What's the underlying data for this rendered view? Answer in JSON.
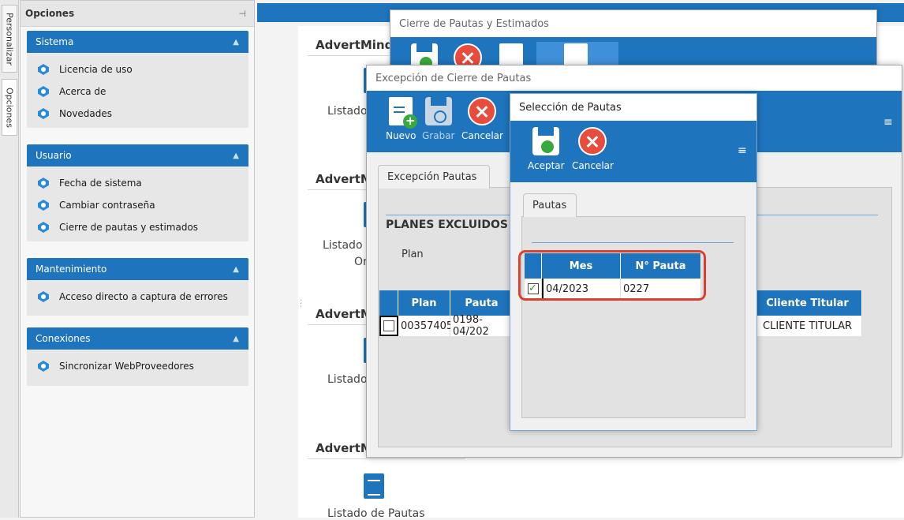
{
  "tabs_vertical": [
    "Personalizar",
    "Opciones"
  ],
  "options_panel": {
    "title": "Opciones",
    "groups": [
      {
        "title": "Sistema",
        "items": [
          "Licencia de uso",
          "Acerca de",
          "Novedades"
        ]
      },
      {
        "title": "Usuario",
        "items": [
          "Fecha de sistema",
          "Cambiar contraseña",
          "Cierre de pautas y estimados"
        ]
      },
      {
        "title": "Mantenimiento",
        "items": [
          "Acceso directo a captura de errores"
        ]
      },
      {
        "title": "Conexiones",
        "items": [
          "Sincronizar WebProveedores"
        ]
      }
    ]
  },
  "main": {
    "sections": [
      "AdvertMind",
      "AdvertM",
      "AdvertM",
      "AdvertM"
    ],
    "listados": [
      "Listado",
      "Listado",
      "Or",
      "Listado",
      "Listado de Pautas"
    ]
  },
  "win_cierre": {
    "title": "Cierre de Pautas y Estimados"
  },
  "win_excepcion": {
    "title": "Excepción de Cierre de Pautas",
    "toolbar": {
      "nuevo": "Nuevo",
      "grabar": "Grabar",
      "cancelar": "Cancelar"
    },
    "tab": "Excepción Pautas",
    "section_title": "PLANES EXCLUIDOS",
    "plan_label": "Plan",
    "grid": {
      "headers": [
        "Plan",
        "Pauta",
        "Cliente Titular"
      ],
      "row": [
        "00357405",
        "0198-04/202",
        "CLIENTE TITULAR"
      ]
    }
  },
  "win_seleccion": {
    "title": "Selección de Pautas",
    "toolbar": {
      "aceptar": "Aceptar",
      "cancelar": "Cancelar"
    },
    "tab": "Pautas",
    "grid": {
      "headers": [
        "Mes",
        "N° Pauta"
      ],
      "row": [
        "04/2023",
        "0227"
      ],
      "checked": true
    }
  },
  "colors": {
    "accent": "#1e74bd",
    "highlight": "#d9402f",
    "cancel": "#e84c3d",
    "add": "#38a93c"
  }
}
